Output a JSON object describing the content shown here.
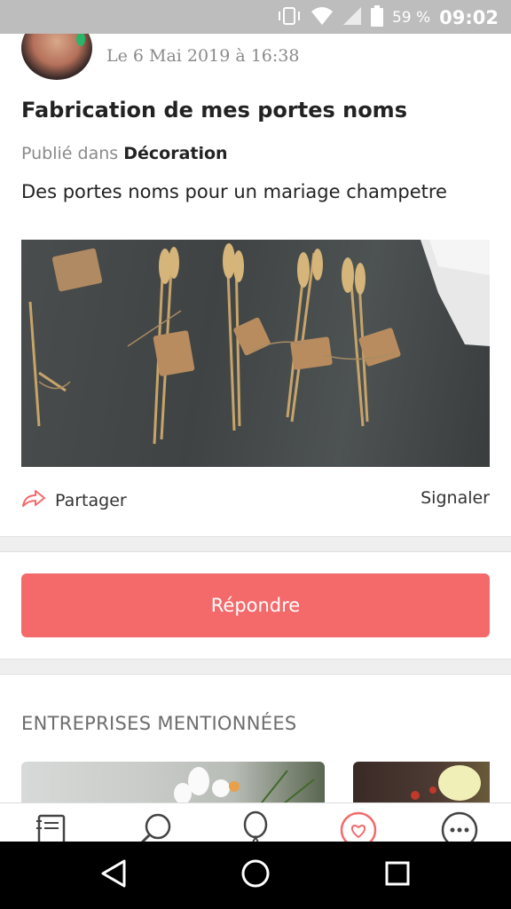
{
  "status_bar": {
    "battery": "59 %",
    "time": "09:02"
  },
  "post": {
    "date": "Le 6 Mai 2019 à 16:38",
    "title": "Fabrication de mes portes noms",
    "published_prefix": "Publié dans",
    "category": "Décoration",
    "description": "Des portes noms pour un mariage champetre"
  },
  "actions": {
    "share_label": "Partager",
    "report_label": "Signaler"
  },
  "reply_button": "Répondre",
  "mentioned": {
    "section_title": "ENTREPRISES MENTIONNÉES"
  },
  "colors": {
    "accent": "#f46a6b",
    "status_bar": "#bdbdbd"
  },
  "tab_bar": {
    "tabs": [
      "notebook-icon",
      "search-icon",
      "balloon-icon",
      "heart-icon",
      "more-icon"
    ],
    "active_tab": "heart-icon"
  },
  "nav_bar": [
    "back-icon",
    "home-icon",
    "recents-icon"
  ]
}
